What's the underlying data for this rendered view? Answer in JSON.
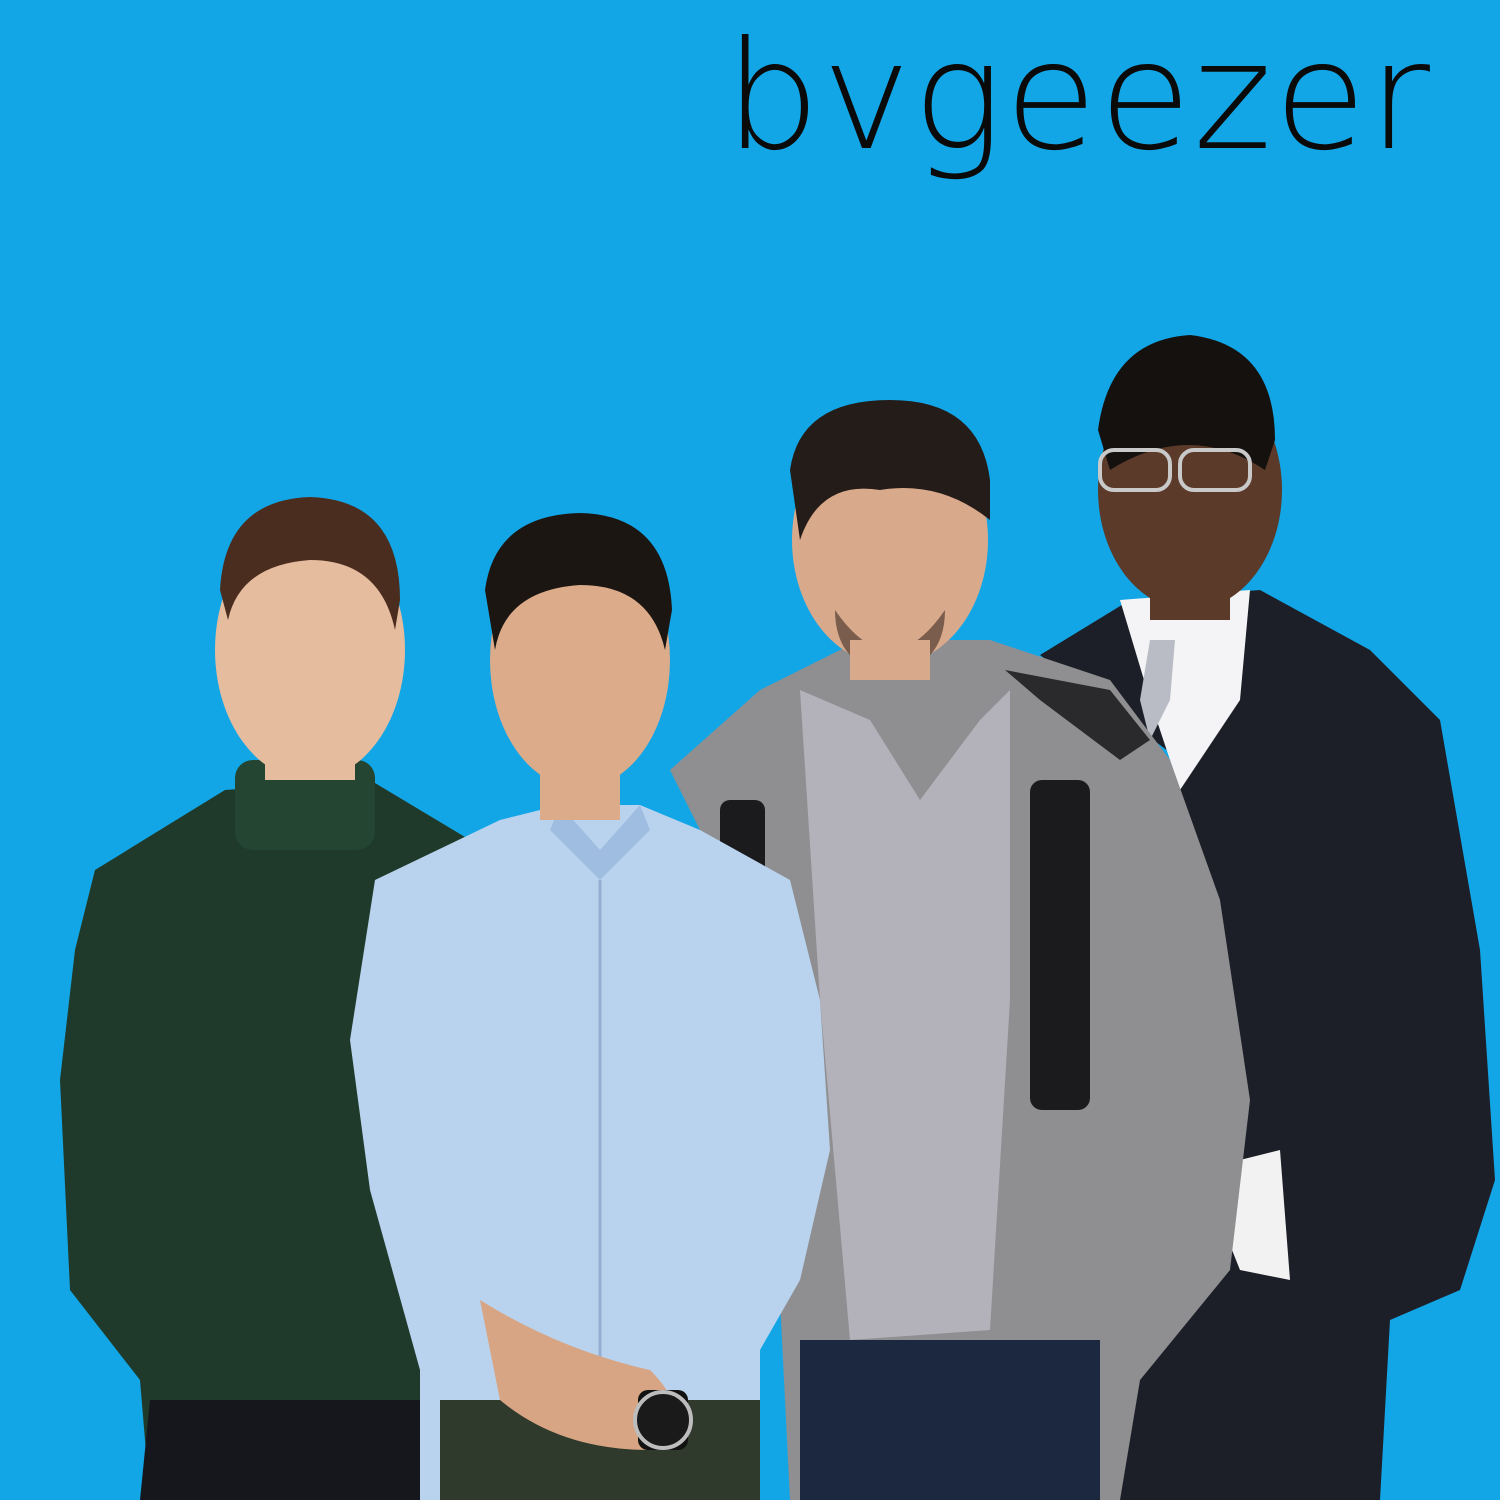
{
  "title": "bvgeezer",
  "colors": {
    "background": "#12a6e6",
    "title": "#0a0a0a"
  },
  "people": [
    {
      "id": "person-1",
      "description_icon": "person-green-turtleneck",
      "outfit_color": "#1f3a2a"
    },
    {
      "id": "person-2",
      "description_icon": "person-light-blue-shirt",
      "outfit_color": "#b9d3ee"
    },
    {
      "id": "person-3",
      "description_icon": "person-grey-hoodie",
      "outfit_color": "#8f8f92"
    },
    {
      "id": "person-4",
      "description_icon": "person-dark-suit",
      "outfit_color": "#1d1f28"
    }
  ]
}
